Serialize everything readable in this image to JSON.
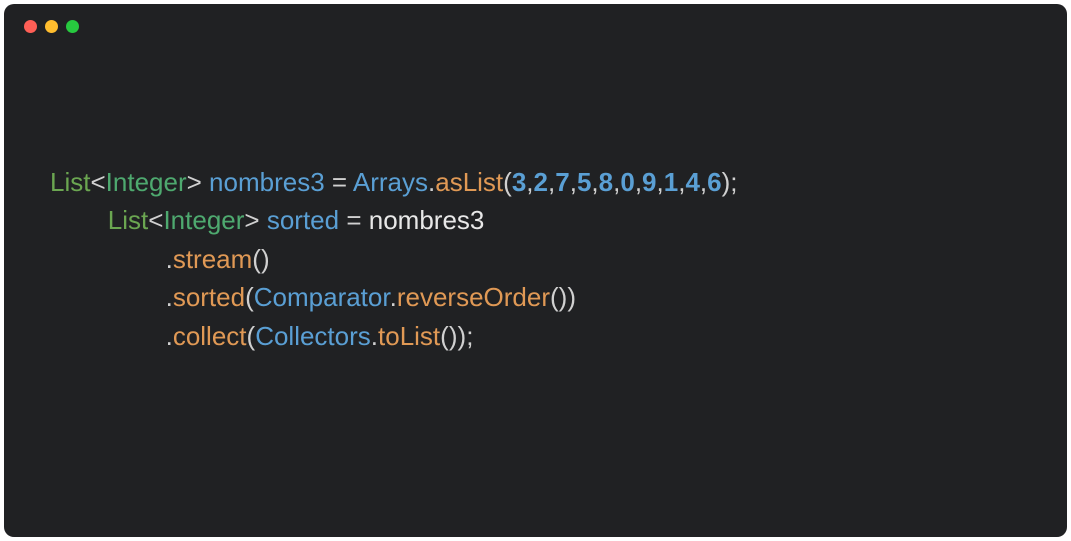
{
  "code": {
    "line1": {
      "type1": "List",
      "angle1": "<",
      "type2": "Integer",
      "angle2": ">",
      "space1": " ",
      "var1": "nombres3",
      "space2": " ",
      "eq": "=",
      "space3": " ",
      "class1": "Arrays",
      "dot1": ".",
      "method1": "asList",
      "paren1": "(",
      "n0": "3",
      "c0": ",",
      "n1": "2",
      "c1": ",",
      "n2": "7",
      "c2": ",",
      "n3": "5",
      "c3": ",",
      "n4": "8",
      "c4": ",",
      "n5": "0",
      "c5": ",",
      "n6": "9",
      "c6": ",",
      "n7": "1",
      "c7": ",",
      "n8": "4",
      "c8": ",",
      "n9": "6",
      "paren2": ")",
      "semi": ";"
    },
    "line2": {
      "indent": "        ",
      "type1": "List",
      "angle1": "<",
      "type2": "Integer",
      "angle2": ">",
      "space1": " ",
      "var1": "sorted",
      "space2": " ",
      "eq": "=",
      "space3": " ",
      "var2": "nombres3"
    },
    "line3": {
      "indent": "                ",
      "dot": ".",
      "method": "stream",
      "paren1": "(",
      "paren2": ")"
    },
    "line4": {
      "indent": "                ",
      "dot": ".",
      "method": "sorted",
      "paren1": "(",
      "class1": "Comparator",
      "dot2": ".",
      "method2": "reverseOrder",
      "paren2": "(",
      "paren3": ")",
      "paren4": ")"
    },
    "line5": {
      "indent": "                ",
      "dot": ".",
      "method": "collect",
      "paren1": "(",
      "class1": "Collectors",
      "dot2": ".",
      "method2": "toList",
      "paren2": "(",
      "paren3": ")",
      "paren4": ")",
      "semi": ";"
    }
  }
}
